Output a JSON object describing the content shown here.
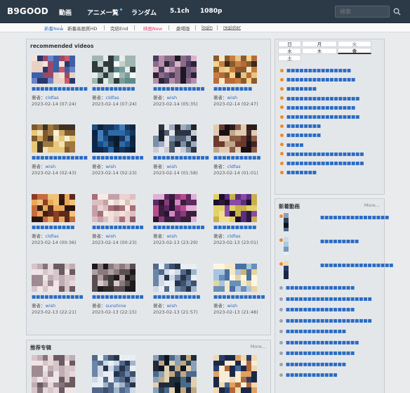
{
  "brand": {
    "logo": "B9GOOD"
  },
  "nav": {
    "items": [
      "動画",
      "アニメ一覧",
      "ランダム",
      "5.1ch",
      "1080p"
    ]
  },
  "search": {
    "placeholder": "検索"
  },
  "subnav": {
    "items": [
      {
        "label": "新番New",
        "style": "blue"
      },
      {
        "label": "新番高画質HD",
        "style": "dark"
      },
      {
        "label": "完結End",
        "style": "dark"
      },
      {
        "label": "映画New",
        "style": "pink"
      },
      {
        "label": "劇場版",
        "style": "dark"
      },
      {
        "label": "login",
        "style": "ul"
      },
      {
        "label": "register",
        "style": "ul"
      }
    ]
  },
  "recommended": {
    "title": "recommended videos",
    "author_prefix": "著者：",
    "videos": [
      {
        "title": "■■■■■■■■■■■■■■",
        "author": "cldfas",
        "date": "2023-02-14 (07:24)"
      },
      {
        "title": "■■■■■■■■■■",
        "author": "cldfas",
        "date": "2023-02-14 (07:24)"
      },
      {
        "title": "■■■■■■■■■■■■",
        "author": "wish",
        "date": "2023-02-14 (05:35)"
      },
      {
        "title": "■■■■■■■■■",
        "author": "wish",
        "date": "2023-02-14 (02:47)"
      },
      {
        "title": "■■■■■■■■■■■■■■■",
        "author": "wish",
        "date": "2023-02-14 (02:43)"
      },
      {
        "title": "■■■■■■■■■■■■",
        "author": "wish",
        "date": "2023-02-14 (02:23)"
      },
      {
        "title": "■■■■■■■■■■■■■",
        "author": "wish",
        "date": "2023-02-14 (01:58)"
      },
      {
        "title": "■■■■■■■■■■■",
        "author": "cldfas",
        "date": "2023-02-14 (01:01)"
      },
      {
        "title": "■■■■■■■■■■",
        "author": "cldfas",
        "date": "2023-02-14 (00:36)"
      },
      {
        "title": "■■■■■■■■■■■■",
        "author": "wish",
        "date": "2023-02-14 (00:23)"
      },
      {
        "title": "■■■■■■■■■■■■",
        "author": "wish",
        "date": "2023-02-13 (23:29)"
      },
      {
        "title": "■■■■■■■■■■",
        "author": "cldfas",
        "date": "2023-02-13 (23:01)"
      },
      {
        "title": "■■■■■■■■■■■■",
        "author": "wish",
        "date": "2023-02-13 (22:21)"
      },
      {
        "title": "■■■■■■■■■■■■",
        "author": "sunshine",
        "date": "2023-02-13 (22:15)"
      },
      {
        "title": "■■■■■■■■■■■",
        "author": "wish",
        "date": "2023-02-13 (21:57)"
      },
      {
        "title": "■■■■■■■■■■■■",
        "author": "wish",
        "date": "2023-02-13 (21:48)"
      }
    ]
  },
  "featured": {
    "title": "推荐专辑",
    "more": "More..."
  },
  "weekdays": {
    "days": [
      "日",
      "月",
      "火",
      "水",
      "木",
      "金",
      "土"
    ],
    "active": "金"
  },
  "day_list": [
    "■■■■■■■■■■■■■■■",
    "■■■■■■■■■■■■■■■■",
    "■■■■■■■",
    "■■■■■■■■■■■■■■■■■",
    "■■■■■■■■■■■■■■■■",
    "■■■■■■■■■■■■■■■■■",
    "■■■■■■■■",
    "■■■■■■■■",
    "■■■■",
    "■■■■■■■■■■■■■■■■■■",
    "■■■■■■■■■■■■■■■■■■",
    "■■■■■■■"
  ],
  "new_videos": {
    "title": "新着動画",
    "more": "More...",
    "thumbs": [
      {
        "title": "■■■■■■■■■■■■■■■■"
      },
      {
        "title": "■■■■■■■■■"
      },
      {
        "title": "■■■■■■■■■■■■■■■■■"
      }
    ],
    "rows": [
      "■■■■■■■■■■■■■■■■",
      "■■■■■■■■■■■■■■■■■■■■",
      "■■■■■■■■■■■■■■■■",
      "■■■■■■■■■■■■■■■■■■■■",
      "■■■■■■■■■■■■■■",
      "■■■■■■■■■■■■■■■■■",
      "■■■■■■■■■■■■■■■■",
      "■■■■■■■■■■■■■■",
      "■■■■■■■■■■■■"
    ]
  },
  "colors": {
    "topbar": "#2c3a48",
    "link": "#2b6cc4",
    "accent_orange": "#f08a24",
    "accent_pink": "#e0457b"
  }
}
